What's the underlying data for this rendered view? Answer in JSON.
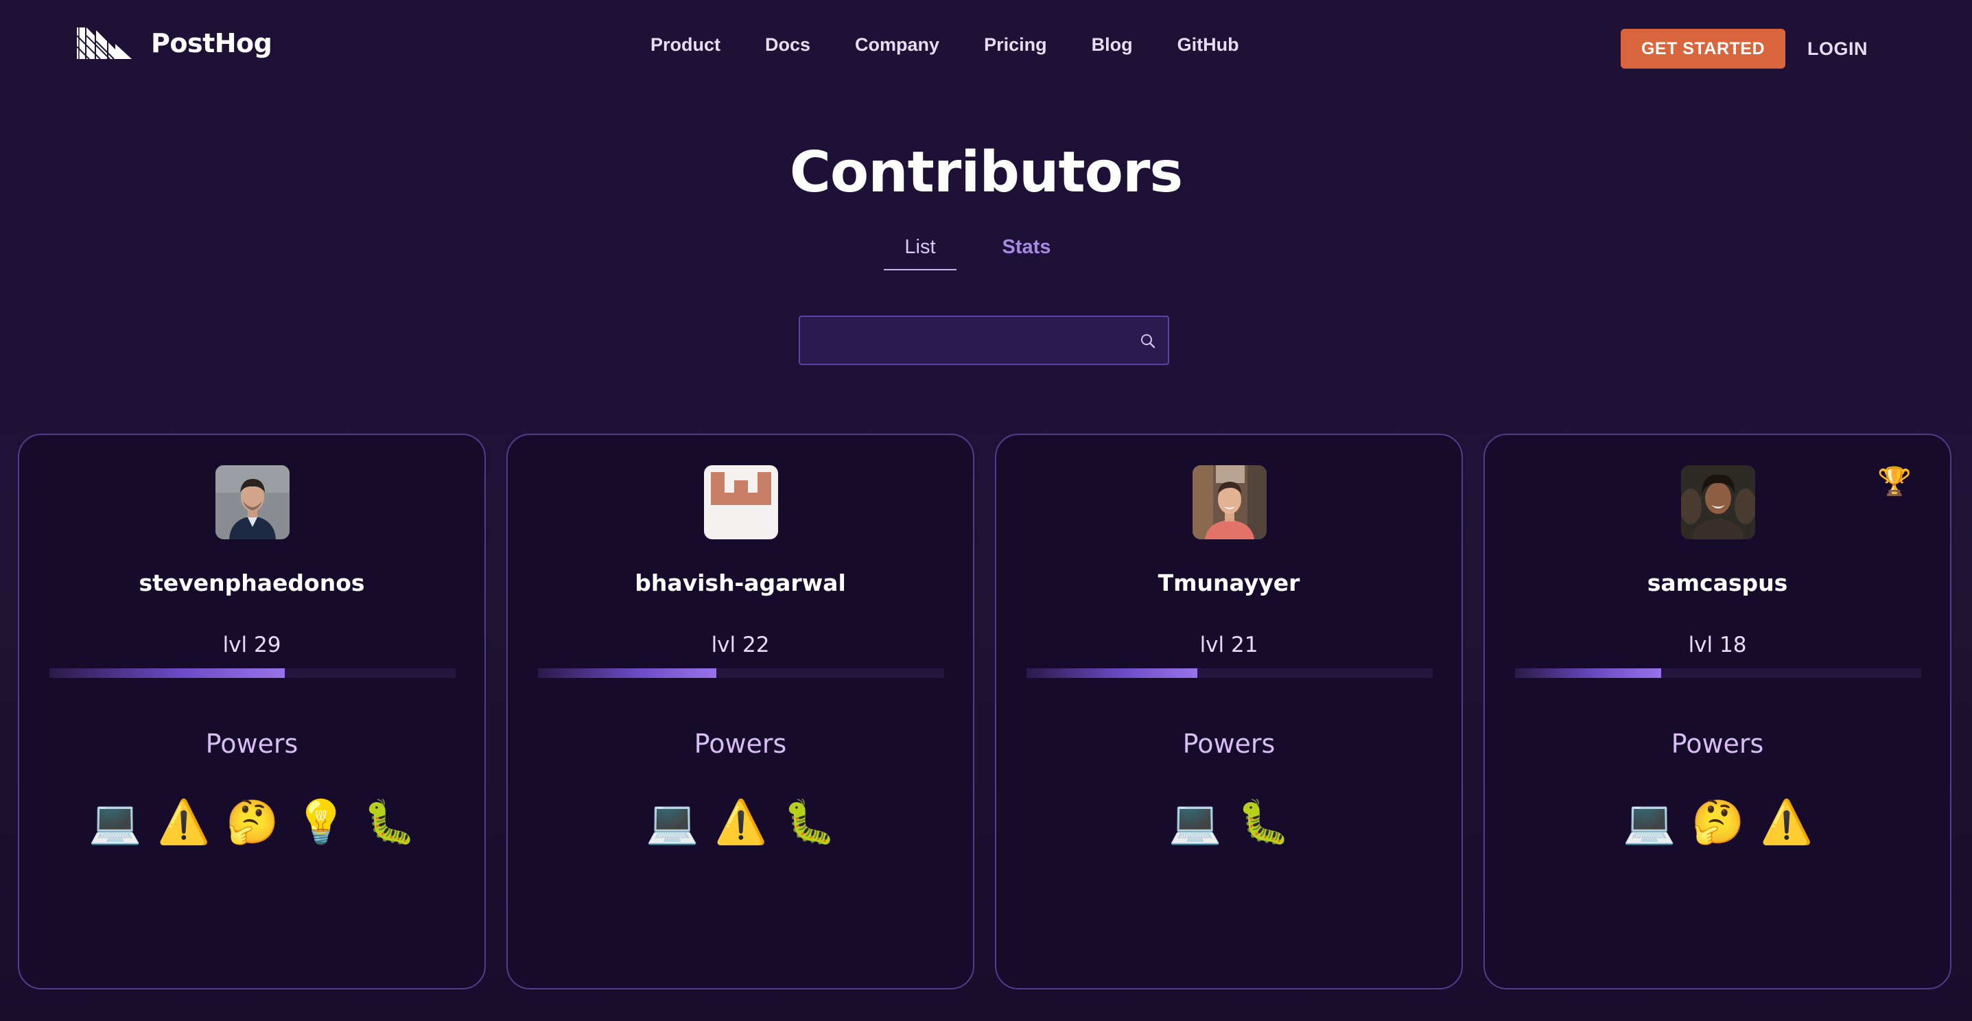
{
  "header": {
    "brand": "PostHog",
    "nav": [
      "Product",
      "Docs",
      "Company",
      "Pricing",
      "Blog",
      "GitHub"
    ],
    "cta_label": "GET STARTED",
    "login_label": "LOGIN",
    "colors": {
      "cta": "#d8653c",
      "background": "#1f1035"
    }
  },
  "main": {
    "title": "Contributors",
    "tabs": [
      {
        "label": "List",
        "active": true
      },
      {
        "label": "Stats",
        "active": false
      }
    ],
    "search": {
      "value": "",
      "placeholder": "",
      "icon": "search-icon"
    }
  },
  "contributors": [
    {
      "username": "stevenphaedonos",
      "level": "lvl 29",
      "xp_progress": 0.58,
      "avatar": "photo-avatar",
      "trophy": false,
      "powers_label": "Powers",
      "powers": [
        "💻",
        "⚠️",
        "🤔",
        "💡",
        "🐛"
      ]
    },
    {
      "username": "bhavish-agarwal",
      "level": "lvl 22",
      "xp_progress": 0.44,
      "avatar": "logo-avatar",
      "trophy": false,
      "powers_label": "Powers",
      "powers": [
        "💻",
        "⚠️",
        "🐛"
      ]
    },
    {
      "username": "Tmunayyer",
      "level": "lvl 21",
      "xp_progress": 0.42,
      "avatar": "photo-avatar",
      "trophy": false,
      "powers_label": "Powers",
      "powers": [
        "💻",
        "🐛"
      ]
    },
    {
      "username": "samcaspus",
      "level": "lvl 18",
      "xp_progress": 0.36,
      "avatar": "photo-avatar",
      "trophy": true,
      "trophy_icon": "🏆",
      "powers_label": "Powers",
      "powers": [
        "💻",
        "🤔",
        "⚠️"
      ]
    }
  ]
}
